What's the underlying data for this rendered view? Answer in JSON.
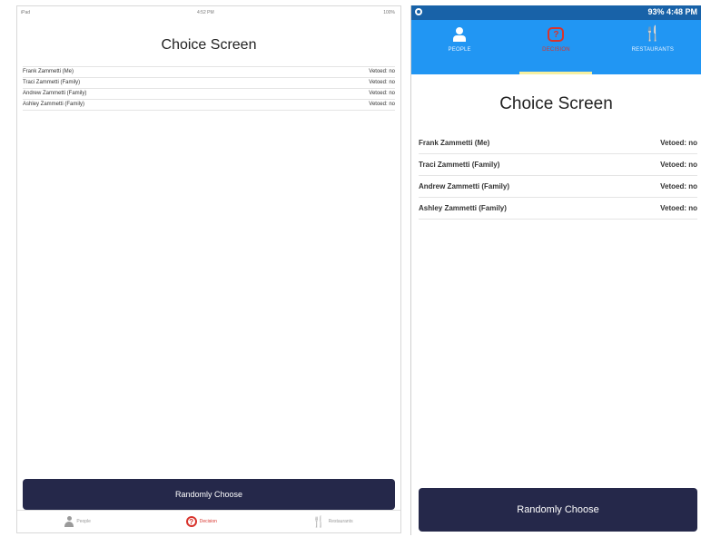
{
  "ipad": {
    "status": {
      "left": "iPad",
      "time": "4:52 PM",
      "right": "100%"
    },
    "title": "Choice Screen",
    "people": [
      {
        "name": "Frank Zammetti (Me)",
        "vetoed": "Vetoed: no"
      },
      {
        "name": "Traci Zammetti (Family)",
        "vetoed": "Vetoed: no"
      },
      {
        "name": "Andrew Zammetti (Family)",
        "vetoed": "Vetoed: no"
      },
      {
        "name": "Ashley Zammetti (Family)",
        "vetoed": "Vetoed: no"
      }
    ],
    "button": "Randomly Choose",
    "tabs": [
      {
        "label": "People",
        "icon": "person-icon"
      },
      {
        "label": "Decision",
        "icon": "decision-icon"
      },
      {
        "label": "Restaurants",
        "icon": "fork-knife-icon"
      }
    ]
  },
  "android": {
    "status": {
      "right": "93% 4:48 PM"
    },
    "tabs": [
      {
        "label": "PEOPLE",
        "icon": "person-icon"
      },
      {
        "label": "DECISION",
        "icon": "decision-icon"
      },
      {
        "label": "RESTAURANTS",
        "icon": "fork-knife-icon"
      }
    ],
    "title": "Choice Screen",
    "people": [
      {
        "name": "Frank Zammetti (Me)",
        "vetoed": "Vetoed: no"
      },
      {
        "name": "Traci Zammetti (Family)",
        "vetoed": "Vetoed: no"
      },
      {
        "name": "Andrew Zammetti (Family)",
        "vetoed": "Vetoed: no"
      },
      {
        "name": "Ashley Zammetti (Family)",
        "vetoed": "Vetoed: no"
      }
    ],
    "button": "Randomly Choose"
  },
  "colors": {
    "button": "#25284a",
    "android_appbar": "#2196f3",
    "android_statusbar": "#1862a8",
    "active_tab": "#d8342d"
  }
}
